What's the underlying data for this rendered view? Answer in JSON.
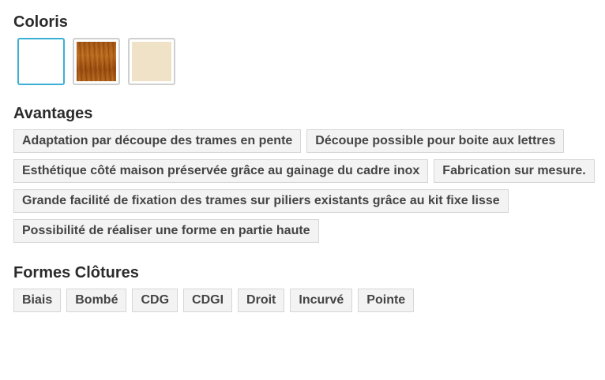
{
  "coloris": {
    "title": "Coloris",
    "swatches": [
      {
        "name": "white",
        "color": "#ffffff",
        "selected": true
      },
      {
        "name": "wood",
        "color": "#a95b17",
        "selected": false
      },
      {
        "name": "cream",
        "color": "#f0e2c6",
        "selected": false
      }
    ]
  },
  "avantages": {
    "title": "Avantages",
    "items": [
      "Adaptation par découpe des trames en pente",
      "Découpe possible pour boite aux lettres",
      "Esthétique côté maison préservée grâce au gainage du cadre inox",
      "Fabrication sur mesure.",
      "Grande facilité de fixation des trames sur piliers existants grâce au kit fixe lisse",
      "Possibilité de réaliser une forme en partie haute"
    ]
  },
  "formes": {
    "title": "Formes Clôtures",
    "items": [
      "Biais",
      "Bombé",
      "CDG",
      "CDGI",
      "Droit",
      "Incurvé",
      "Pointe"
    ]
  },
  "colors": {
    "selected_border": "#3ab0d6",
    "tag_background": "#f3f3f3",
    "tag_border": "#d6d6d6"
  }
}
